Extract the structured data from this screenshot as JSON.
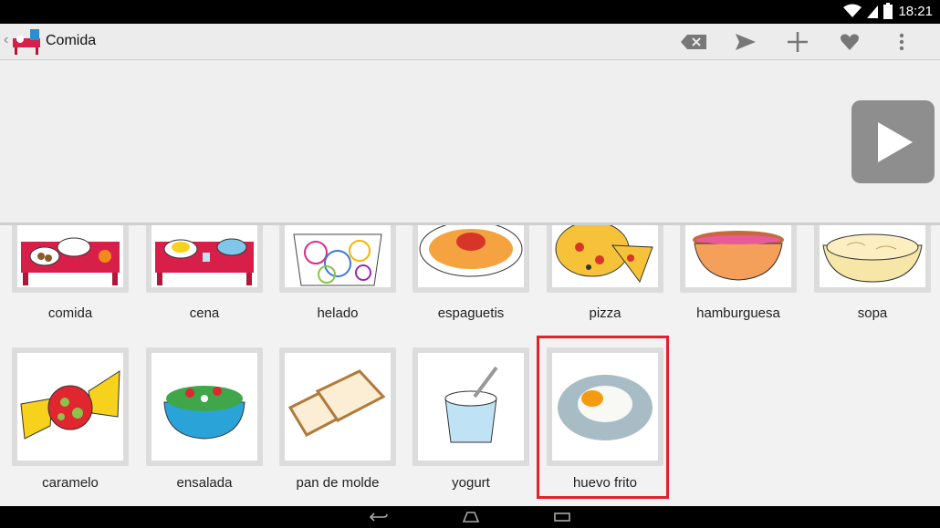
{
  "status": {
    "time": "18:21"
  },
  "toolbar": {
    "title": "Comida"
  },
  "board": {
    "row1": [
      {
        "label": "comida",
        "icon": "set-table-icon"
      },
      {
        "label": "cena",
        "icon": "dinner-table-icon"
      },
      {
        "label": "helado",
        "icon": "ice-cream-cup-icon"
      },
      {
        "label": "espaguetis",
        "icon": "spaghetti-icon"
      },
      {
        "label": "pizza",
        "icon": "pizza-icon"
      },
      {
        "label": "hamburguesa",
        "icon": "hamburger-icon"
      },
      {
        "label": "sopa",
        "icon": "soup-bowl-icon"
      }
    ],
    "row2": [
      {
        "label": "caramelo",
        "icon": "candy-icon"
      },
      {
        "label": "ensalada",
        "icon": "salad-bowl-icon"
      },
      {
        "label": "pan de molde",
        "icon": "sliced-bread-icon"
      },
      {
        "label": "yogurt",
        "icon": "yogurt-icon"
      },
      {
        "label": "huevo frito",
        "icon": "fried-egg-photo"
      }
    ]
  },
  "colors": {
    "highlight": "#e3212b",
    "play_button": "#8e8e8e"
  }
}
